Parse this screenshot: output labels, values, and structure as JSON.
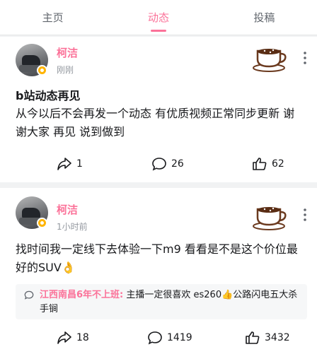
{
  "tabs": [
    {
      "label": "主页"
    },
    {
      "label": "动态"
    },
    {
      "label": "投稿"
    }
  ],
  "posts": [
    {
      "author": "柯洁",
      "time": "刚刚",
      "title": "b站动态再见",
      "body": "从今以后不会再发一个动态 有优质视频正常同步更新 谢谢大家 再见 说到做到",
      "reposts": "1",
      "comments": "26",
      "likes": "62"
    },
    {
      "author": "柯洁",
      "time": "1小时前",
      "body": "找时间我一定线下去体验一下m9 看看是不是这个价位最好的SUV👌",
      "pinned_comment": {
        "name": "江西南昌6年不上班:",
        "text": " 主播一定很喜欢 es260👍公路闪电五大杀手锏"
      },
      "reposts": "18",
      "comments": "1419",
      "likes": "3432"
    }
  ],
  "colors": {
    "accent": "#fb7299",
    "badge": "#ffb400"
  },
  "icons": [
    "share-icon",
    "comment-icon",
    "like-icon",
    "coffee-cup-icon",
    "more-icon"
  ]
}
